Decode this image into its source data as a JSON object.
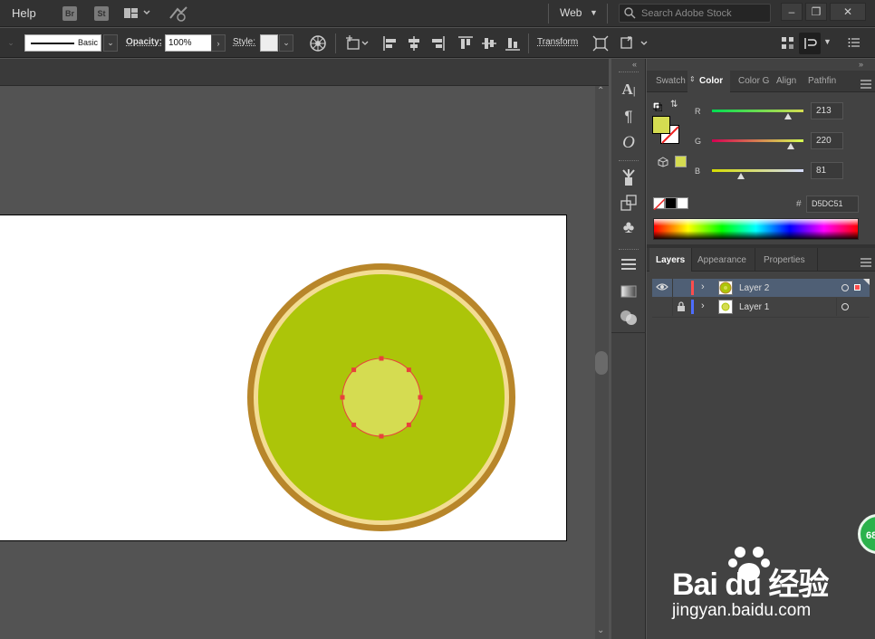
{
  "menubar": {
    "help_label": "Help",
    "bridge_label": "Br",
    "stock_label": "St",
    "workspace_label": "Web",
    "search_placeholder": "Search Adobe Stock"
  },
  "controlbar": {
    "stroke_profile": "Basic",
    "opacity_label": "Opacity:",
    "opacity_value": "100%",
    "style_label": "Style:",
    "transform_label": "Transform"
  },
  "color_panel": {
    "tabs": [
      "Swatch",
      "Color",
      "Color G",
      "Align",
      "Pathfin"
    ],
    "active_tab": "Color",
    "channels": [
      {
        "label": "R",
        "value": "213",
        "fraction": 0.835
      },
      {
        "label": "G",
        "value": "220",
        "fraction": 0.863
      },
      {
        "label": "B",
        "value": "81",
        "fraction": 0.318
      }
    ],
    "hex_symbol": "#",
    "hex_value": "D5DC51",
    "fill_color": "#D5DC51"
  },
  "layers_panel": {
    "tabs": [
      "Layers",
      "Appearance",
      "Properties"
    ],
    "active_tab": "Layers",
    "layers": [
      {
        "name": "Layer 2",
        "color": "#ff4d4d",
        "selected": true
      },
      {
        "name": "Layer 1",
        "color": "#4d6dff",
        "selected": false
      }
    ]
  },
  "artwork": {
    "outer_ring_color": "#b8862a",
    "inner_ring_color": "#f3dc93",
    "body_color": "#acc509",
    "center_color": "#d5dc51",
    "selection_color": "#e8423c"
  },
  "watermark": {
    "logo_text": "Bai du 经验",
    "url_text": "jingyan.baidu.com",
    "badge_text": "68"
  }
}
